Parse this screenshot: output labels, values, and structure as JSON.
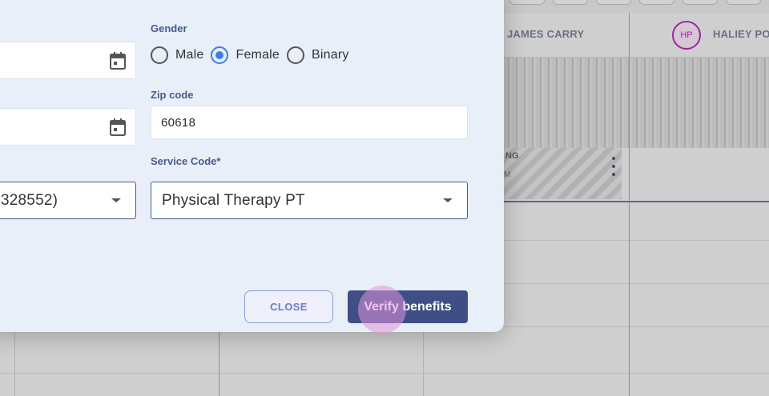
{
  "background": {
    "staff": [
      {
        "name": "JAMES CARRY"
      },
      {
        "name": "HALIEY POT",
        "avatar_initials": "HP"
      }
    ],
    "event": {
      "title": "NG",
      "time": "M"
    }
  },
  "modal": {
    "gender": {
      "label": "Gender",
      "options": [
        {
          "label": "Male",
          "checked": false
        },
        {
          "label": "Female",
          "checked": true
        },
        {
          "label": "Binary",
          "checked": false
        }
      ]
    },
    "zip": {
      "label": "Zip code",
      "value": "60618"
    },
    "service_code": {
      "label": "Service Code*",
      "value": "Physical Therapy PT"
    },
    "left_select_value": "328552)",
    "buttons": {
      "close": "CLOSE",
      "verify": "Verify benefits"
    }
  },
  "colors": {
    "accent": "#3f4f86",
    "radio_checked": "#3d7ee6",
    "avatar": "#a024a0"
  }
}
